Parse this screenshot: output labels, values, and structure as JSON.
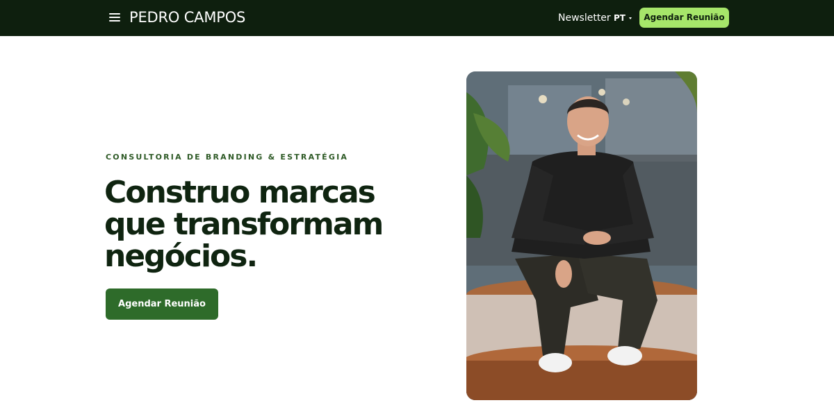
{
  "header": {
    "logo": "PEDRO CAMPOS",
    "nav": {
      "newsletter": "Newsletter",
      "language": "PT",
      "cta": "Agendar Reunião"
    }
  },
  "hero": {
    "eyebrow": "CONSULTORIA DE BRANDING & ESTRATÉGIA",
    "headline": "Construo marcas que transformam negócios.",
    "cta": "Agendar Reunião"
  },
  "colors": {
    "header_bg": "#0e1f0e",
    "accent_light": "#a6e66a",
    "accent_dark": "#2e6b2a",
    "text_dark": "#0f2410"
  },
  "icons": {
    "menu": "hamburger-menu-icon",
    "language": "chevron-down-icon"
  }
}
